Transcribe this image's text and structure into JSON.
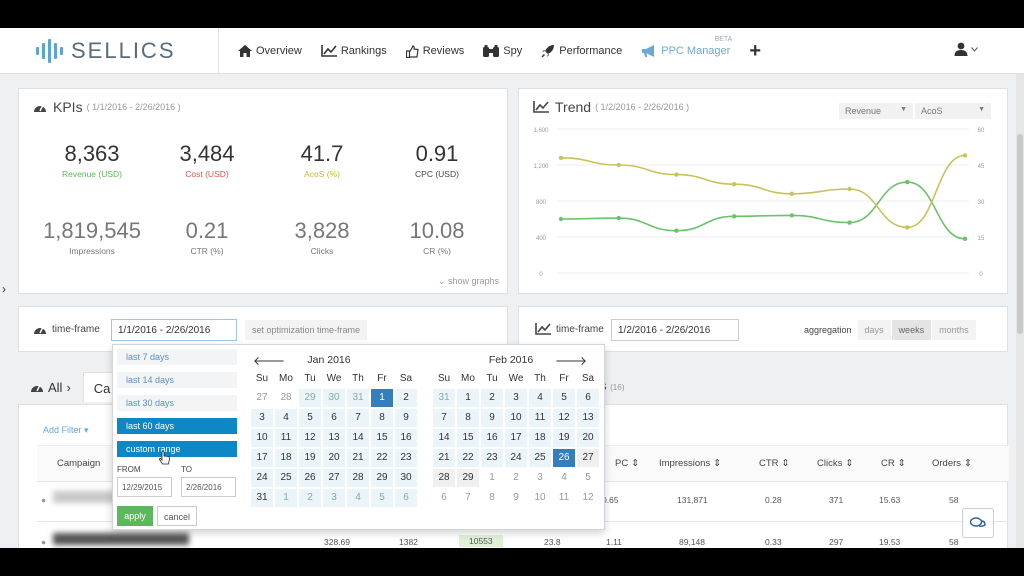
{
  "app": {
    "logo_text": "SELLICS"
  },
  "nav": {
    "items": [
      {
        "label": "Overview",
        "icon": "home-icon"
      },
      {
        "label": "Rankings",
        "icon": "line-chart-icon"
      },
      {
        "label": "Reviews",
        "icon": "thumbs-up-icon"
      },
      {
        "label": "Spy",
        "icon": "binoculars-icon"
      },
      {
        "label": "Performance",
        "icon": "rocket-icon"
      },
      {
        "label": "PPC Manager",
        "icon": "megaphone-icon",
        "badge": "BETA"
      }
    ],
    "add": "+"
  },
  "kpis": {
    "title": "KPIs",
    "range": "( 1/1/2016 - 2/26/2016 )",
    "items": [
      {
        "value": "8,363",
        "label": "Revenue (USD)",
        "color": "#5cb85c"
      },
      {
        "value": "3,484",
        "label": "Cost (USD)",
        "color": "#d9534f"
      },
      {
        "value": "41.7",
        "label": "AcoS (%)",
        "color": "#c9b73a"
      },
      {
        "value": "0.91",
        "label": "CPC (USD)",
        "color": "#444444"
      },
      {
        "value": "1,819,545",
        "label": "Impressions",
        "color": "#777777"
      },
      {
        "value": "0.21",
        "label": "CTR (%)",
        "color": "#777777"
      },
      {
        "value": "3,828",
        "label": "Clicks",
        "color": "#777777"
      },
      {
        "value": "10.08",
        "label": "CR (%)",
        "color": "#777777"
      }
    ],
    "show_graphs": "show graphs"
  },
  "trend": {
    "title": "Trend",
    "range": "( 1/2/2016 - 2/26/2016 )",
    "select_left": "Revenue",
    "select_right": "AcoS"
  },
  "chart_data": {
    "type": "line",
    "x": [
      1,
      2,
      3,
      4,
      5,
      6,
      7,
      8
    ],
    "series": [
      {
        "values": [
          600,
          610,
          470,
          630,
          640,
          560,
          1010,
          380
        ],
        "color": "#6cc26c",
        "axis": "left"
      },
      {
        "values": [
          48,
          45,
          41,
          37,
          33,
          35,
          19,
          49
        ],
        "color": "#c8c25a",
        "axis": "right"
      }
    ],
    "ylim_left": [
      0,
      1600
    ],
    "yticks_left": [
      "1,600",
      "1,200",
      "800",
      "400",
      "0"
    ],
    "ylim_right": [
      0,
      60
    ],
    "yticks_right": [
      "60",
      "45",
      "30",
      "15",
      "0"
    ]
  },
  "timeframe": {
    "label": "time-frame",
    "value": "1/1/2016 - 2/26/2016",
    "set_opt": "set optimization time-frame",
    "right_label": "time-frame",
    "right_value": "1/2/2016 - 2/26/2016",
    "aggregation_label": "aggregation",
    "aggregation": [
      "days",
      "weeks",
      "months"
    ]
  },
  "picker": {
    "ranges": [
      "last 7 days",
      "last 14 days",
      "last 30 days",
      "last 60 days",
      "custom range"
    ],
    "from_label": "FROM",
    "to_label": "TO",
    "from_value": "12/29/2015",
    "to_value": "2/26/2016",
    "apply": "apply",
    "cancel": "cancel",
    "weekdays": [
      "Su",
      "Mo",
      "Tu",
      "We",
      "Th",
      "Fr",
      "Sa"
    ],
    "left_month": "Jan 2016",
    "right_month": "Feb 2016",
    "left_days": [
      "27",
      "28",
      "29",
      "30",
      "31",
      "1",
      "2",
      "3",
      "4",
      "5",
      "6",
      "7",
      "8",
      "9",
      "10",
      "11",
      "12",
      "13",
      "14",
      "15",
      "16",
      "17",
      "18",
      "19",
      "20",
      "21",
      "22",
      "23",
      "24",
      "25",
      "26",
      "27",
      "28",
      "29",
      "30",
      "31",
      "1",
      "2",
      "3",
      "4",
      "5",
      "6"
    ],
    "right_days": [
      "31",
      "1",
      "2",
      "3",
      "4",
      "5",
      "6",
      "7",
      "8",
      "9",
      "10",
      "11",
      "12",
      "13",
      "14",
      "15",
      "16",
      "17",
      "18",
      "19",
      "20",
      "21",
      "22",
      "23",
      "24",
      "25",
      "26",
      "27",
      "28",
      "29",
      "1",
      "2",
      "3",
      "4",
      "5",
      "6",
      "7",
      "8",
      "9",
      "10",
      "11",
      "12"
    ]
  },
  "tabs": {
    "all": "All",
    "second_start": "Ca",
    "hidden_label": "s",
    "hidden_count": "(16)"
  },
  "table": {
    "add_filter": "Add Filter",
    "headers": [
      "Campaign",
      "PC",
      "Impressions",
      "CTR",
      "Clicks",
      "CR",
      "Orders"
    ],
    "rows": [
      {
        "pc": "0.65",
        "impressions": "131,871",
        "ctr": "0.28",
        "clicks": "371",
        "cr": "15.63",
        "orders": "58"
      },
      {
        "c1": "328.69",
        "c2": "1382",
        "c3": "10553",
        "c4": "23.8",
        "pc": "1.11",
        "impressions": "89,148",
        "ctr": "0.33",
        "clicks": "297",
        "cr": "19.53",
        "orders": "58"
      }
    ]
  }
}
